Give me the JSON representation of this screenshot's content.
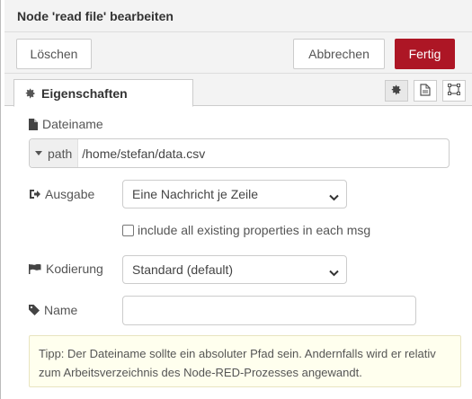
{
  "header": {
    "title": "Node 'read file' bearbeiten"
  },
  "toolbar": {
    "delete_label": "Löschen",
    "cancel_label": "Abbrechen",
    "done_label": "Fertig"
  },
  "tabs": {
    "properties_label": "Eigenschaften"
  },
  "form": {
    "filename_label": "Dateiname",
    "path_type": "path",
    "path_value": "/home/stefan/data.csv",
    "output_label": "Ausgabe",
    "output_value": "Eine Nachricht je Zeile",
    "include_label": "include all existing properties in each msg",
    "encoding_label": "Kodierung",
    "encoding_value": "Standard (default)",
    "name_label": "Name",
    "name_value": ""
  },
  "tip": {
    "text": "Tipp: Der Dateiname sollte ein absoluter Pfad sein. Andernfalls wird er relativ zum Arbeitsverzeichnis des Node-RED-Prozesses angewandt."
  },
  "colors": {
    "primary": "#ad1625",
    "tip_bg": "#ffffee"
  }
}
